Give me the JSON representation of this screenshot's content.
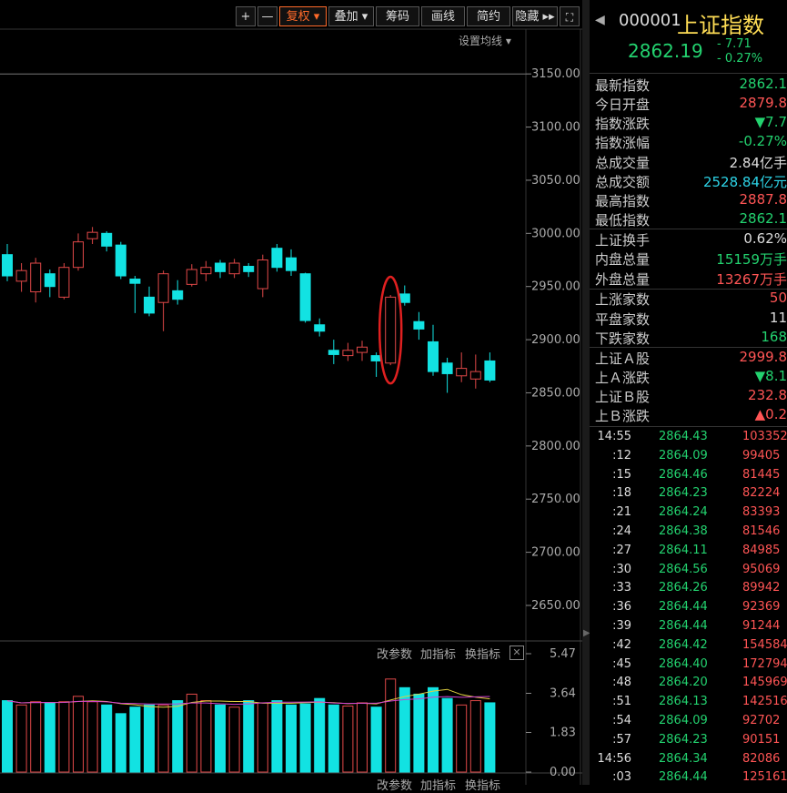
{
  "toolbar": {
    "plus": "+",
    "minus": "—",
    "fuquan": "复权",
    "diejia": "叠加",
    "choumao": "筹码",
    "huaxian": "画线",
    "jianyue": "简约",
    "yincang": "隐藏",
    "fullscreen_icon": "expand-icon"
  },
  "ma_settings": "设置均线",
  "indicator": {
    "param": "改参数",
    "add": "加指标",
    "switch": "换指标",
    "close": "✕"
  },
  "indicator_bottom": {
    "param": "改参数",
    "add": "加指标",
    "switch": "换指标"
  },
  "stock": {
    "code": "000001",
    "name": "上证指数",
    "price": "2862.19",
    "change": "- 7.71",
    "change_pct": "- 0.27%"
  },
  "quotes": [
    {
      "label": "最新指数",
      "value": "2862.1",
      "color": "#23d26f"
    },
    {
      "label": "今日开盘",
      "value": "2879.8",
      "color": "#ff5555"
    },
    {
      "label": "指数涨跌",
      "value": "▼7.7",
      "color": "#23d26f"
    },
    {
      "label": "指数涨幅",
      "value": "-0.27%",
      "color": "#23d26f"
    },
    {
      "label": "总成交量",
      "value": "2.84亿手",
      "color": "#ddd"
    },
    {
      "label": "总成交额",
      "value": "2528.84亿元",
      "color": "#2dd3e6"
    },
    {
      "label": "最高指数",
      "value": "2887.8",
      "color": "#ff5555"
    },
    {
      "label": "最低指数",
      "value": "2862.1",
      "color": "#23d26f"
    },
    {
      "label": "上证换手",
      "value": "0.62%",
      "color": "#ddd"
    },
    {
      "label": "内盘总量",
      "value": "15159万手",
      "color": "#23d26f"
    },
    {
      "label": "外盘总量",
      "value": "13267万手",
      "color": "#ff5555"
    },
    {
      "label": "上涨家数",
      "value": "50",
      "color": "#ff5555"
    },
    {
      "label": "平盘家数",
      "value": "11",
      "color": "#ddd"
    },
    {
      "label": "下跌家数",
      "value": "168",
      "color": "#23d26f"
    },
    {
      "label": "上证Ａ股",
      "value": "2999.8",
      "color": "#ff5555"
    },
    {
      "label": "上Ａ涨跌",
      "value": "▼8.1",
      "color": "#23d26f"
    },
    {
      "label": "上证Ｂ股",
      "value": "232.8",
      "color": "#ff5555"
    },
    {
      "label": "上Ｂ涨跌",
      "value": "▲0.2",
      "color": "#ff5555"
    }
  ],
  "ticks": [
    {
      "time": "14:55",
      "price": "2864.43",
      "vol": "103352"
    },
    {
      "time": ":12",
      "price": "2864.09",
      "vol": "99405"
    },
    {
      "time": ":15",
      "price": "2864.46",
      "vol": "81445"
    },
    {
      "time": ":18",
      "price": "2864.23",
      "vol": "82224"
    },
    {
      "time": ":21",
      "price": "2864.24",
      "vol": "83393"
    },
    {
      "time": ":24",
      "price": "2864.38",
      "vol": "81546"
    },
    {
      "time": ":27",
      "price": "2864.11",
      "vol": "84985"
    },
    {
      "time": ":30",
      "price": "2864.56",
      "vol": "95069"
    },
    {
      "time": ":33",
      "price": "2864.26",
      "vol": "89942"
    },
    {
      "time": ":36",
      "price": "2864.44",
      "vol": "92369"
    },
    {
      "time": ":39",
      "price": "2864.44",
      "vol": "91244"
    },
    {
      "time": ":42",
      "price": "2864.42",
      "vol": "154584"
    },
    {
      "time": ":45",
      "price": "2864.40",
      "vol": "172794"
    },
    {
      "time": ":48",
      "price": "2864.20",
      "vol": "145969"
    },
    {
      "time": ":51",
      "price": "2864.13",
      "vol": "142516"
    },
    {
      "time": ":54",
      "price": "2864.09",
      "vol": "92702"
    },
    {
      "time": ":57",
      "price": "2864.23",
      "vol": "90151"
    },
    {
      "time": "14:56",
      "price": "2864.34",
      "vol": "82086"
    },
    {
      "time": ":03",
      "price": "2864.44",
      "vol": "125161"
    }
  ],
  "chart_data": {
    "type": "candlestick",
    "y_ticks": [
      "3150.00",
      "3100.00",
      "3050.00",
      "3000.00",
      "2950.00",
      "2900.00",
      "2850.00",
      "2800.00",
      "2750.00",
      "2700.00",
      "2650.00"
    ],
    "ylim": [
      2620,
      3175
    ],
    "vol_ticks": [
      "5.47",
      "3.64",
      "1.83",
      "0.00"
    ],
    "vol_lim": [
      0,
      5.47
    ],
    "candles": [
      [
        2980,
        2960,
        2990,
        2955
      ],
      [
        2955,
        2965,
        2972,
        2945
      ],
      [
        2945,
        2972,
        2977,
        2935
      ],
      [
        2962,
        2950,
        2966,
        2940
      ],
      [
        2940,
        2968,
        2972,
        2938
      ],
      [
        2968,
        2992,
        3000,
        2965
      ],
      [
        2995,
        3001,
        3006,
        2990
      ],
      [
        3000,
        2988,
        3002,
        2983
      ],
      [
        2989,
        2960,
        2992,
        2957
      ],
      [
        2957,
        2953,
        2960,
        2925
      ],
      [
        2940,
        2925,
        2950,
        2922
      ],
      [
        2935,
        2962,
        2965,
        2908
      ],
      [
        2946,
        2938,
        2956,
        2933
      ],
      [
        2952,
        2966,
        2971,
        2950
      ],
      [
        2962,
        2968,
        2974,
        2955
      ],
      [
        2972,
        2964,
        2975,
        2958
      ],
      [
        2962,
        2972,
        2976,
        2958
      ],
      [
        2969,
        2964,
        2972,
        2959
      ],
      [
        2948,
        2975,
        2980,
        2940
      ],
      [
        2986,
        2968,
        2990,
        2964
      ],
      [
        2977,
        2965,
        2985,
        2960
      ],
      [
        2962,
        2918,
        2963,
        2916
      ],
      [
        2914,
        2908,
        2920,
        2903
      ],
      [
        2890,
        2886,
        2900,
        2877
      ],
      [
        2885,
        2890,
        2897,
        2880
      ],
      [
        2888,
        2893,
        2899,
        2880
      ],
      [
        2885,
        2880,
        2888,
        2865
      ],
      [
        2878,
        2940,
        2942,
        2876
      ],
      [
        2943,
        2935,
        2951,
        2932
      ],
      [
        2917,
        2910,
        2926,
        2900
      ],
      [
        2898,
        2870,
        2914,
        2866
      ],
      [
        2878,
        2868,
        2883,
        2850
      ],
      [
        2866,
        2873,
        2888,
        2860
      ],
      [
        2863,
        2870,
        2886,
        2854
      ],
      [
        2880,
        2862,
        2888,
        2860
      ]
    ],
    "volumes": [
      3.3,
      3.1,
      3.25,
      3.2,
      3.25,
      3.5,
      3.25,
      3.1,
      2.7,
      3.0,
      3.1,
      3.1,
      3.3,
      3.6,
      3.3,
      3.1,
      3.0,
      3.3,
      3.2,
      3.3,
      3.1,
      3.15,
      3.4,
      3.1,
      3.05,
      3.2,
      3.0,
      4.3,
      3.9,
      3.6,
      3.9,
      3.4,
      3.1,
      3.3,
      3.2
    ],
    "annotation": {
      "type": "ellipse",
      "candle_index": 27,
      "color": "#e02020"
    }
  }
}
